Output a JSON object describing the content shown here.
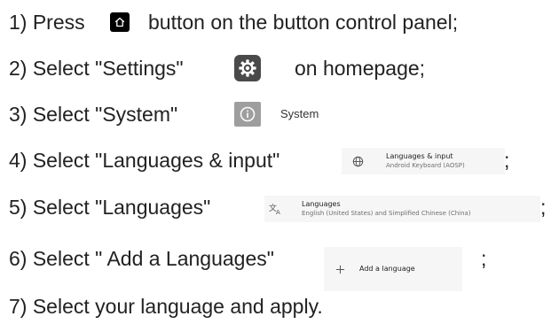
{
  "steps": [
    {
      "lead": "1) Press",
      "icon": "home-icon",
      "tail": "button on the button control panel;"
    },
    {
      "lead": "2) Select \"Settings\"",
      "icon": "settings-gear-icon",
      "tail": "on homepage;"
    },
    {
      "lead": "3) Select \"System\"",
      "icon": "info-icon",
      "label": "System"
    },
    {
      "lead": "4) Select \"Languages & input\"",
      "icon": "globe-icon",
      "card_title": "Languages & input",
      "card_sub": "Android Keyboard (AOSP)",
      "tail": ";"
    },
    {
      "lead": "5) Select \"Languages\"",
      "icon": "translate-icon",
      "card_title": "Languages",
      "card_sub": "English (United States) and Simplified Chinese (China)",
      "tail": ";"
    },
    {
      "lead": "6) Select \" Add a Languages\"",
      "icon": "plus-icon",
      "card_title": "Add a language",
      "tail": ";"
    },
    {
      "lead": "7) Select your language and apply."
    }
  ]
}
